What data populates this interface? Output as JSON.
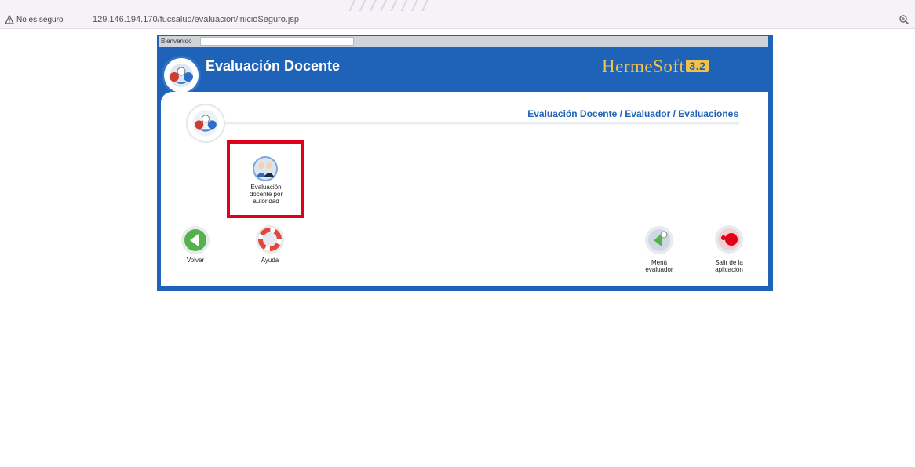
{
  "browser": {
    "security_label": "No es seguro",
    "url": "129.146.194.170/fucsalud/evaluacion/inicioSeguro.jsp",
    "icons": {
      "warning": "warning-triangle-icon",
      "zoom": "zoom-icon"
    }
  },
  "app": {
    "welcome_label": "Bienvenido",
    "welcome_value": "",
    "title": "Evaluación Docente",
    "brand": "HermeSoft",
    "brand_version": "3.2",
    "breadcrumb": "Evaluación Docente / Evaluador / Evaluaciones",
    "tile": {
      "label_lines": [
        "Evaluación",
        "docente por",
        "autoridad"
      ],
      "icon": "people-evaluation-icon"
    },
    "nav": {
      "back": {
        "label": "Volver",
        "icon": "arrow-left-icon"
      },
      "help": {
        "label": "Ayuda",
        "icon": "lifebuoy-icon"
      },
      "menu": {
        "label_lines": [
          "Menú",
          "evaluador"
        ],
        "icon": "menu-back-icon"
      },
      "exit": {
        "label_lines": [
          "Salir de la",
          "aplicación"
        ],
        "icon": "exit-icon"
      }
    },
    "colors": {
      "brand_blue": "#1f63b8",
      "brand_gold": "#f0c14b",
      "highlight_red": "#e0001b"
    }
  }
}
